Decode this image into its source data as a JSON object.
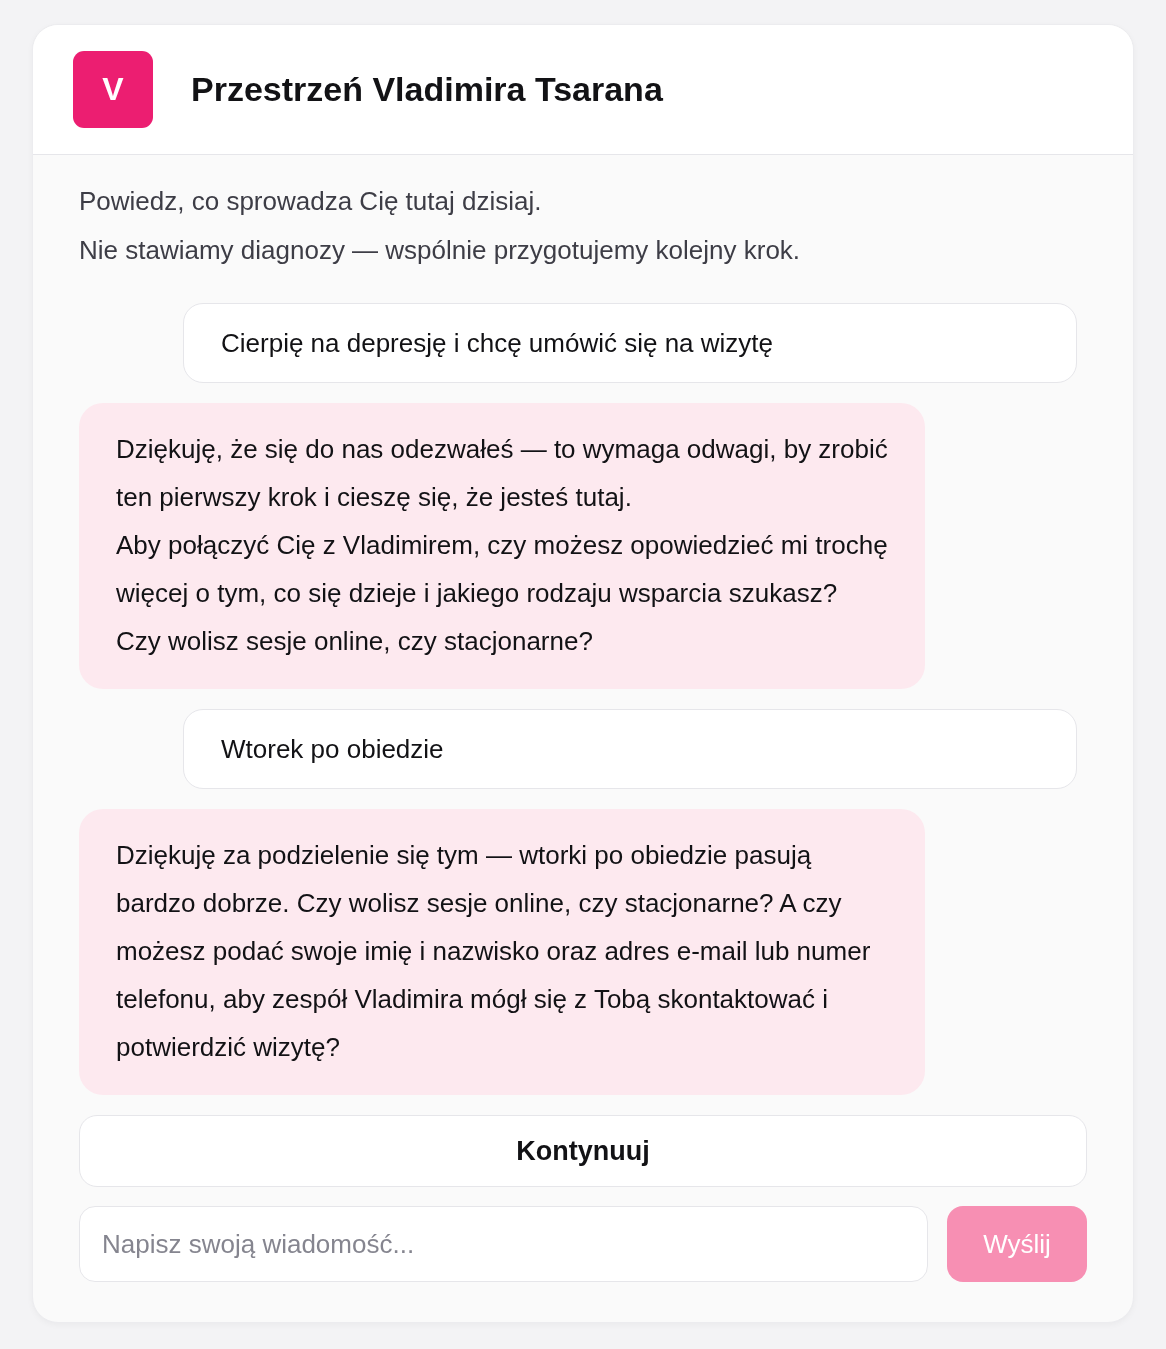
{
  "header": {
    "avatar_letter": "V",
    "title": "Przestrzeń Vladimira Tsarana"
  },
  "intro": [
    "Powiedz, co sprowadza Cię tutaj dzisiaj.",
    "Nie stawiamy diagnozy — wspólnie przygotujemy kolejny krok."
  ],
  "messages": [
    {
      "kind": "user",
      "paragraphs": [
        "Cierpię na depresję i chcę umówić się na wizytę"
      ]
    },
    {
      "kind": "assistant",
      "paragraphs": [
        "Dziękuję, że się do nas odezwałeś — to wymaga odwagi, by zrobić ten pierwszy krok i cieszę się, że jesteś tutaj.",
        "Aby połączyć Cię z Vladimirem, czy możesz opowiedzieć mi trochę więcej o tym, co się dzieje i jakiego rodzaju wsparcia szukasz? Czy wolisz sesje online, czy stacjonarne?"
      ]
    },
    {
      "kind": "user",
      "paragraphs": [
        "Wtorek po obiedzie"
      ]
    },
    {
      "kind": "assistant",
      "paragraphs": [
        "Dziękuję za podzielenie się tym — wtorki po obiedzie pasują bardzo dobrze. Czy wolisz sesje online, czy stacjonarne? A czy możesz podać swoje imię i nazwisko oraz adres e-mail lub numer telefonu, aby zespół Vladimira mógł się z Tobą skontaktować i potwierdzić wizytę?"
      ]
    }
  ],
  "continue_button": {
    "label": "Kontynuuj"
  },
  "composer": {
    "placeholder": "Napisz swoją wiadomość...",
    "send_button": {
      "label": "Wyślij",
      "disabled": true
    }
  }
}
